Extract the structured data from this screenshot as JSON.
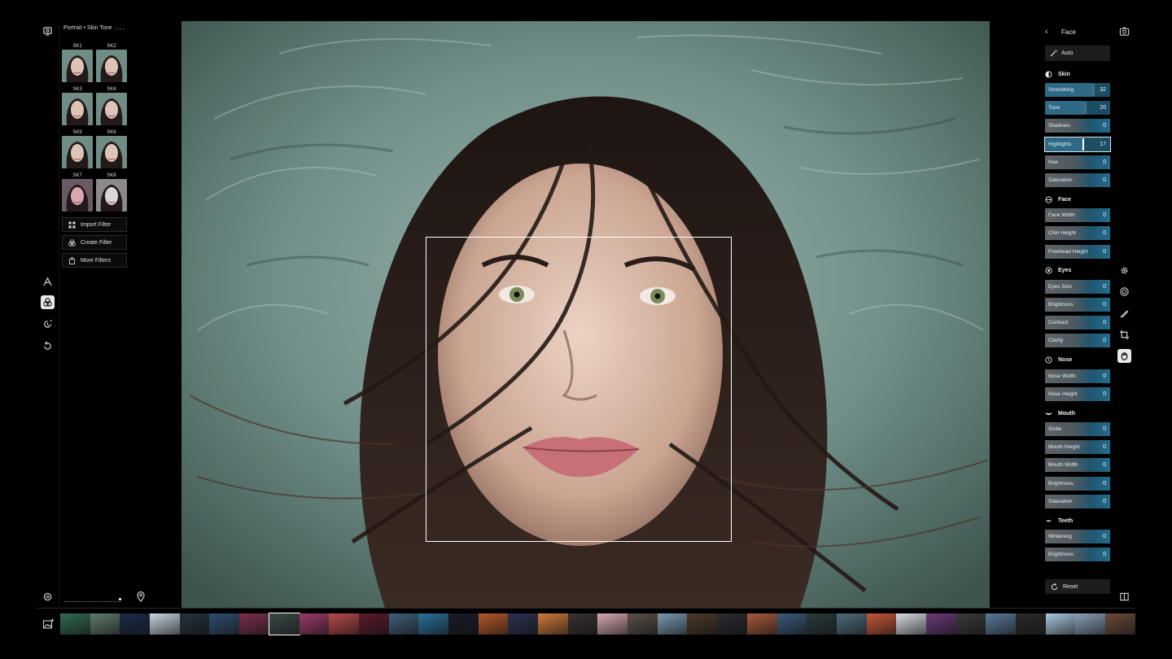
{
  "left_rail": {
    "tools": [
      {
        "name": "presets-icon"
      },
      {
        "name": "text-tool-icon"
      },
      {
        "name": "filters-icon",
        "active": true
      },
      {
        "name": "history-icon"
      },
      {
        "name": "undo-icon"
      }
    ]
  },
  "filter_panel": {
    "title": "Portrait • Skin Tone",
    "more_label": "···",
    "thumbnails": [
      {
        "label": "SK1"
      },
      {
        "label": "SK2"
      },
      {
        "label": "SK3"
      },
      {
        "label": "SK4"
      },
      {
        "label": "SK5"
      },
      {
        "label": "SK6"
      },
      {
        "label": "SK7"
      },
      {
        "label": "SK8"
      }
    ],
    "import_label": "Import Filter",
    "create_label": "Create Filter",
    "more_filters_label": "More Filters"
  },
  "adjust_panel": {
    "title": "Face",
    "auto_label": "Auto",
    "reset_label": "Reset",
    "sections": [
      {
        "title": "Skin",
        "icon": "half-circle-icon",
        "sliders": [
          {
            "label": "Smoothing",
            "value": "32"
          },
          {
            "label": "Tone",
            "value": "20"
          },
          {
            "label": "Shadows",
            "value": "0"
          },
          {
            "label": "Highlights",
            "value": "17",
            "active": true
          },
          {
            "label": "Hue",
            "value": "0"
          },
          {
            "label": "Saturation",
            "value": "0"
          }
        ]
      },
      {
        "title": "Face",
        "icon": "face-outline-icon",
        "sliders": [
          {
            "label": "Face Width",
            "value": "0"
          },
          {
            "label": "Chin Height",
            "value": "0"
          },
          {
            "label": "Forehead Height",
            "value": "0"
          }
        ]
      },
      {
        "title": "Eyes",
        "icon": "eye-icon",
        "sliders": [
          {
            "label": "Eyes Size",
            "value": "0"
          },
          {
            "label": "Brightness",
            "value": "0"
          },
          {
            "label": "Contrast",
            "value": "0"
          },
          {
            "label": "Clarity",
            "value": "0"
          }
        ]
      },
      {
        "title": "Nose",
        "icon": "nose-icon",
        "sliders": [
          {
            "label": "Nose Width",
            "value": "0"
          },
          {
            "label": "Nose Height",
            "value": "0"
          }
        ]
      },
      {
        "title": "Mouth",
        "icon": "mouth-icon",
        "sliders": [
          {
            "label": "Smile",
            "value": "0"
          },
          {
            "label": "Mouth Height",
            "value": "0"
          },
          {
            "label": "Mouth Width",
            "value": "0"
          },
          {
            "label": "Brightness",
            "value": "0"
          },
          {
            "label": "Saturation",
            "value": "0"
          }
        ]
      },
      {
        "title": "Teeth",
        "icon": "teeth-icon",
        "sliders": [
          {
            "label": "Whitening",
            "value": "0"
          },
          {
            "label": "Brightness",
            "value": "0"
          }
        ]
      }
    ]
  },
  "right_rail": {
    "tools": [
      {
        "name": "camera-export-icon"
      },
      {
        "name": "adjust-gear-icon"
      },
      {
        "name": "retouch-icon"
      },
      {
        "name": "brush-icon"
      },
      {
        "name": "crop-icon"
      },
      {
        "name": "face-icon",
        "active": true
      },
      {
        "name": "compare-icon"
      }
    ]
  },
  "colors": {
    "slider_track": "#1b4d63",
    "slider_fill": "#2e6a86",
    "background": "#000000",
    "accent": "#ffffff"
  },
  "filmstrip": {
    "selected_index": 7,
    "frames": [
      "#2f6b4f",
      "#5f7b6a",
      "#1b2a4a",
      "#c7d6e0",
      "#24323f",
      "#2d4f6f",
      "#7a2f4a",
      "#3b4a47",
      "#9b3a6a",
      "#b84a4a",
      "#5a1a2a",
      "#3f5f7a",
      "#2a6f9a",
      "#1a1a2a",
      "#b5582a",
      "#2b3150",
      "#d07a3a",
      "#3a3030",
      "#d9a9b2",
      "#5a5048",
      "#7a9ab0",
      "#4a3a2a",
      "#2a2a30",
      "#a85a3a",
      "#3a5a7a",
      "#2a3a3a",
      "#4f6a7a",
      "#c6583a",
      "#d8dde2",
      "#6a3a7a",
      "#3a3a3a",
      "#5a7a9a",
      "#2a2a2a",
      "#a8c8e0",
      "#8aa0b8",
      "#6a4a3a"
    ]
  }
}
